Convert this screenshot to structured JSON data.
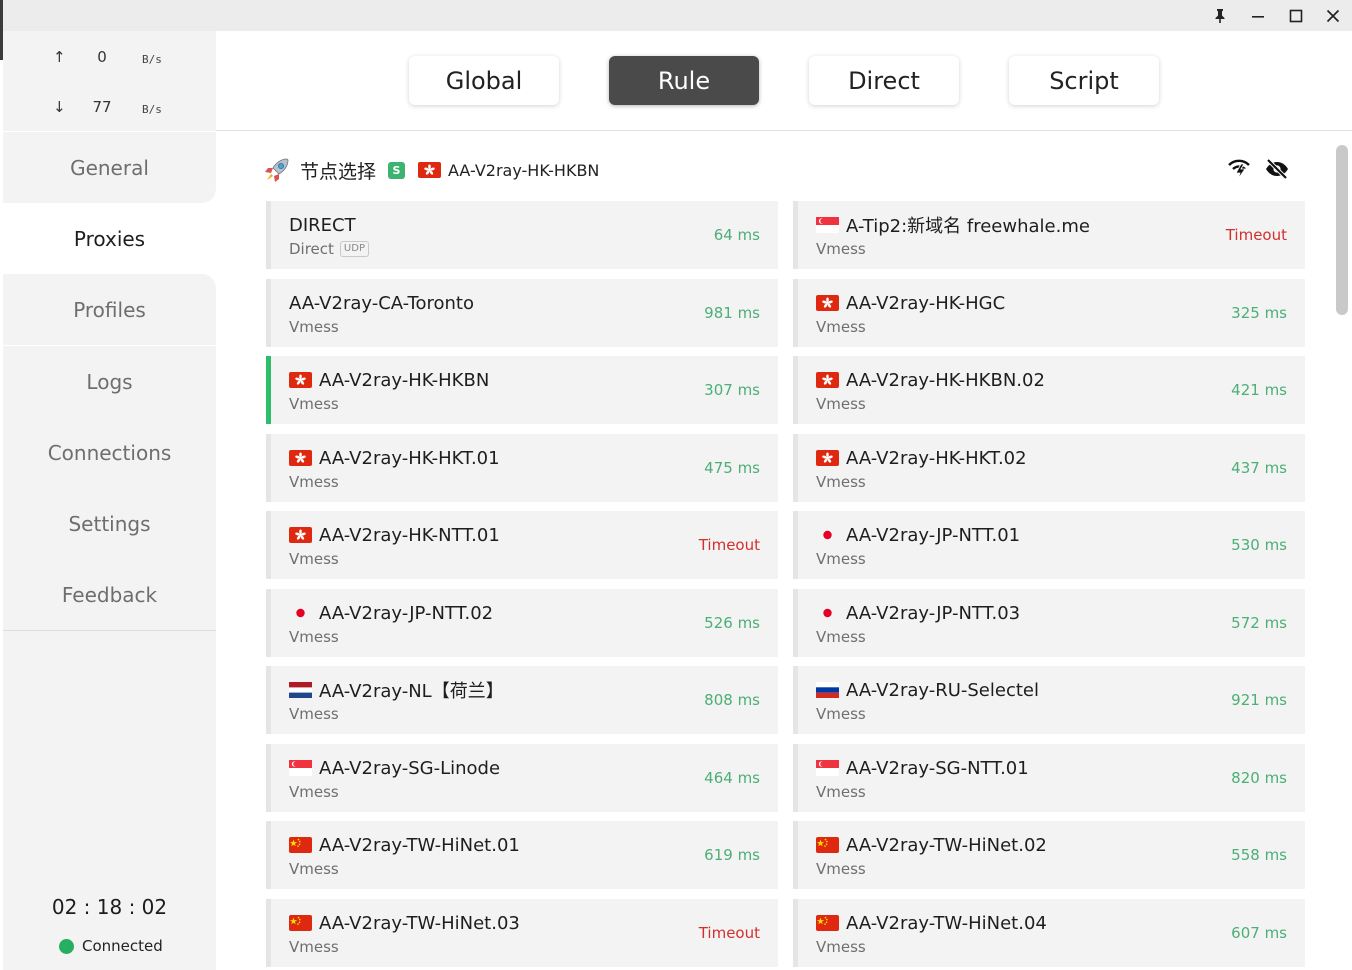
{
  "window": {
    "controls": {
      "pin_icon": "pin-icon",
      "minimize_icon": "minimize-icon",
      "maximize_icon": "maximize-icon",
      "close_icon": "close-icon"
    }
  },
  "traffic": {
    "up_arrow": "↑",
    "up_value": "0",
    "up_unit": "B/s",
    "down_arrow": "↓",
    "down_value": "77",
    "down_unit": "B/s"
  },
  "sidebar": {
    "items": [
      {
        "label": "General"
      },
      {
        "label": "Proxies"
      },
      {
        "label": "Profiles"
      },
      {
        "label": "Logs"
      },
      {
        "label": "Connections"
      },
      {
        "label": "Settings"
      },
      {
        "label": "Feedback"
      }
    ],
    "active": "Proxies",
    "clock": "02 : 18 : 02",
    "status": "Connected",
    "status_color": "#27ae60"
  },
  "modes": {
    "items": [
      {
        "label": "Global"
      },
      {
        "label": "Rule"
      },
      {
        "label": "Direct"
      },
      {
        "label": "Script"
      }
    ],
    "active": "Rule"
  },
  "group": {
    "icon": "rocket-icon",
    "name": "节点选择",
    "badge": "S",
    "selected_flag": "hk",
    "selected": "AA-V2ray-HK-HKBN",
    "actions": [
      "speedtest-icon",
      "hide-icon"
    ]
  },
  "proxies": [
    {
      "name": "DIRECT",
      "flag": "",
      "type": "Direct",
      "udp": "UDP",
      "delay": "64 ms",
      "status": "ok"
    },
    {
      "name": "A-Tip2:新域名 freewhale.me",
      "flag": "sg",
      "type": "Vmess",
      "delay": "Timeout",
      "status": "bad"
    },
    {
      "name": "AA-V2ray-CA-Toronto",
      "flag": "",
      "type": "Vmess",
      "delay": "981 ms",
      "status": "ok"
    },
    {
      "name": "AA-V2ray-HK-HGC",
      "flag": "hk",
      "type": "Vmess",
      "delay": "325 ms",
      "status": "ok"
    },
    {
      "name": "AA-V2ray-HK-HKBN",
      "flag": "hk",
      "type": "Vmess",
      "delay": "307 ms",
      "status": "ok",
      "selected": true
    },
    {
      "name": "AA-V2ray-HK-HKBN.02",
      "flag": "hk",
      "type": "Vmess",
      "delay": "421 ms",
      "status": "ok"
    },
    {
      "name": "AA-V2ray-HK-HKT.01",
      "flag": "hk",
      "type": "Vmess",
      "delay": "475 ms",
      "status": "ok"
    },
    {
      "name": "AA-V2ray-HK-HKT.02",
      "flag": "hk",
      "type": "Vmess",
      "delay": "437 ms",
      "status": "ok"
    },
    {
      "name": "AA-V2ray-HK-NTT.01",
      "flag": "hk",
      "type": "Vmess",
      "delay": "Timeout",
      "status": "bad"
    },
    {
      "name": "AA-V2ray-JP-NTT.01",
      "flag": "jp",
      "type": "Vmess",
      "delay": "530 ms",
      "status": "ok"
    },
    {
      "name": "AA-V2ray-JP-NTT.02",
      "flag": "jp",
      "type": "Vmess",
      "delay": "526 ms",
      "status": "ok"
    },
    {
      "name": "AA-V2ray-JP-NTT.03",
      "flag": "jp",
      "type": "Vmess",
      "delay": "572 ms",
      "status": "ok"
    },
    {
      "name": "AA-V2ray-NL【荷兰】",
      "flag": "nl",
      "type": "Vmess",
      "delay": "808 ms",
      "status": "ok"
    },
    {
      "name": "AA-V2ray-RU-Selectel",
      "flag": "ru",
      "type": "Vmess",
      "delay": "921 ms",
      "status": "ok"
    },
    {
      "name": "AA-V2ray-SG-Linode",
      "flag": "sg",
      "type": "Vmess",
      "delay": "464 ms",
      "status": "ok"
    },
    {
      "name": "AA-V2ray-SG-NTT.01",
      "flag": "sg",
      "type": "Vmess",
      "delay": "820 ms",
      "status": "ok"
    },
    {
      "name": "AA-V2ray-TW-HiNet.01",
      "flag": "tw",
      "type": "Vmess",
      "delay": "619 ms",
      "status": "ok"
    },
    {
      "name": "AA-V2ray-TW-HiNet.02",
      "flag": "tw",
      "type": "Vmess",
      "delay": "558 ms",
      "status": "ok"
    },
    {
      "name": "AA-V2ray-TW-HiNet.03",
      "flag": "tw",
      "type": "Vmess",
      "delay": "Timeout",
      "status": "bad"
    },
    {
      "name": "AA-V2ray-TW-HiNet.04",
      "flag": "tw",
      "type": "Vmess",
      "delay": "607 ms",
      "status": "ok"
    }
  ],
  "colors": {
    "delay_ok": "#4caf76",
    "delay_timeout": "#d32f2f",
    "selected_accent": "#2ebd6b",
    "mode_active": "#4a4a4a"
  }
}
